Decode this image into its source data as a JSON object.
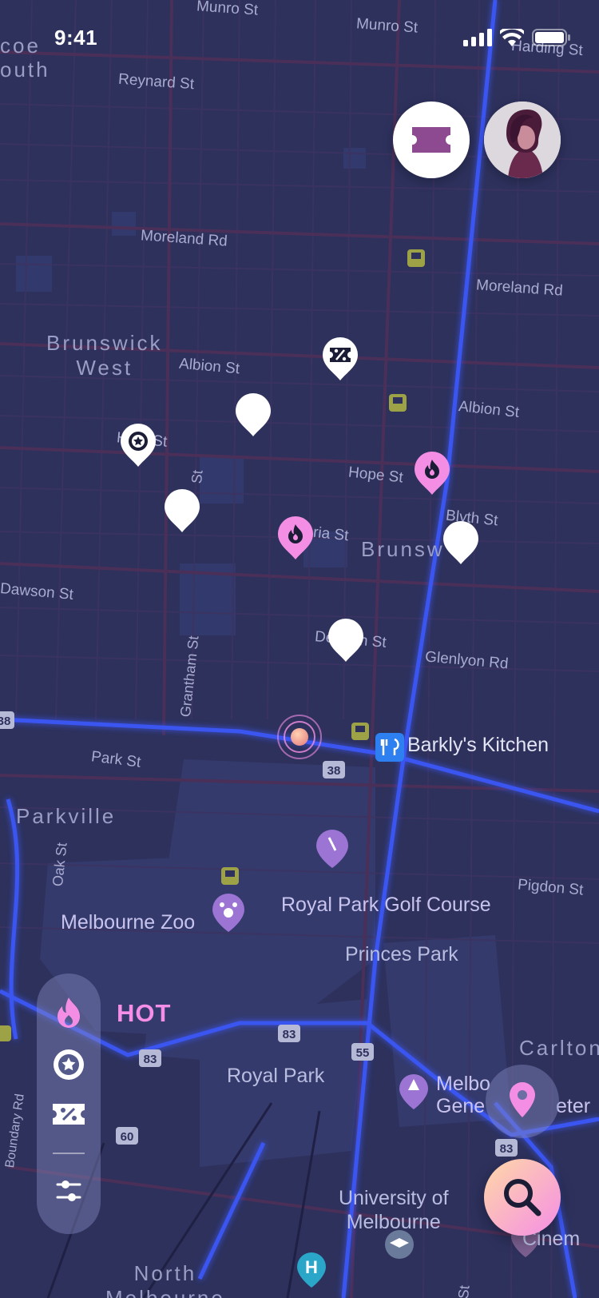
{
  "status_bar": {
    "time": "9:41"
  },
  "map": {
    "street_labels": [
      {
        "id": "munro-st-1",
        "text": "Munro St"
      },
      {
        "id": "munro-st-2",
        "text": "Munro St"
      },
      {
        "id": "harding-st",
        "text": "Harding St"
      },
      {
        "id": "reynard-st",
        "text": "Reynard St"
      },
      {
        "id": "moreland-rd-1",
        "text": "Moreland Rd"
      },
      {
        "id": "moreland-rd-2",
        "text": "Moreland Rd"
      },
      {
        "id": "albion-st-1",
        "text": "Albion St"
      },
      {
        "id": "albion-st-2",
        "text": "Albion St"
      },
      {
        "id": "hope-st",
        "text": "Hope St"
      },
      {
        "id": "blyth-st",
        "text": "Blyth St"
      },
      {
        "id": "victoria-st",
        "text": "ria St"
      },
      {
        "id": "dawson-st-1",
        "text": "Dawson St"
      },
      {
        "id": "dawson-st-2",
        "text": "De      n St"
      },
      {
        "id": "glenlyon-rd",
        "text": "Glenlyon Rd"
      },
      {
        "id": "grantham-st",
        "text": "Grantham St"
      },
      {
        "id": "park-st",
        "text": "Park St"
      },
      {
        "id": "oak-st",
        "text": "Oak St"
      },
      {
        "id": "pigdon-st",
        "text": "Pigdon St"
      },
      {
        "id": "boundary-rd",
        "text": "Boundary Rd"
      },
      {
        "id": "h-st",
        "text": "H      St"
      },
      {
        "id": "x-st",
        "text": "St"
      },
      {
        "id": "cut-st",
        "text": "St"
      }
    ],
    "area_labels": [
      {
        "id": "coe",
        "text": "coe"
      },
      {
        "id": "outh",
        "text": "outh"
      },
      {
        "id": "brunswick-west",
        "text": "Brunswick\nWest"
      },
      {
        "id": "brunswick",
        "text": "Brunsw"
      },
      {
        "id": "parkville",
        "text": "Parkville"
      },
      {
        "id": "carlton",
        "text": "Carlton"
      },
      {
        "id": "north-melbourne",
        "text": "North\nMelbourne"
      }
    ],
    "poi_labels": [
      {
        "id": "barklys-kitchen",
        "text": "Barkly's Kitchen"
      },
      {
        "id": "royal-park-golf",
        "text": "Royal Park Golf Course"
      },
      {
        "id": "melbourne-zoo",
        "text": "Melbourne Zoo"
      },
      {
        "id": "princes-park",
        "text": "Princes Park"
      },
      {
        "id": "royal-park",
        "text": "Royal Park"
      },
      {
        "id": "melb-general",
        "text": "Melbo\nGene"
      },
      {
        "id": "cemetery",
        "text": "eter"
      },
      {
        "id": "uni-melbourne",
        "text": "University of\nMelbourne"
      },
      {
        "id": "cinema",
        "text": "Cinem"
      }
    ],
    "route_shields": [
      "38",
      "38",
      "83",
      "83",
      "55",
      "60",
      "83"
    ],
    "accent_color": "#f48ee5",
    "route_color": "#3b55f0"
  },
  "controls": {
    "ticket_icon": "ticket-icon",
    "avatar": "user-avatar",
    "location_icon": "location-pin-icon",
    "search_icon": "search-icon"
  },
  "filters": {
    "items": [
      {
        "icon": "flame-icon",
        "label": "HOT",
        "active": true
      },
      {
        "icon": "star-badge-icon",
        "active": false
      },
      {
        "icon": "discount-ticket-icon",
        "active": false
      },
      {
        "icon": "sliders-icon",
        "active": false
      }
    ]
  }
}
